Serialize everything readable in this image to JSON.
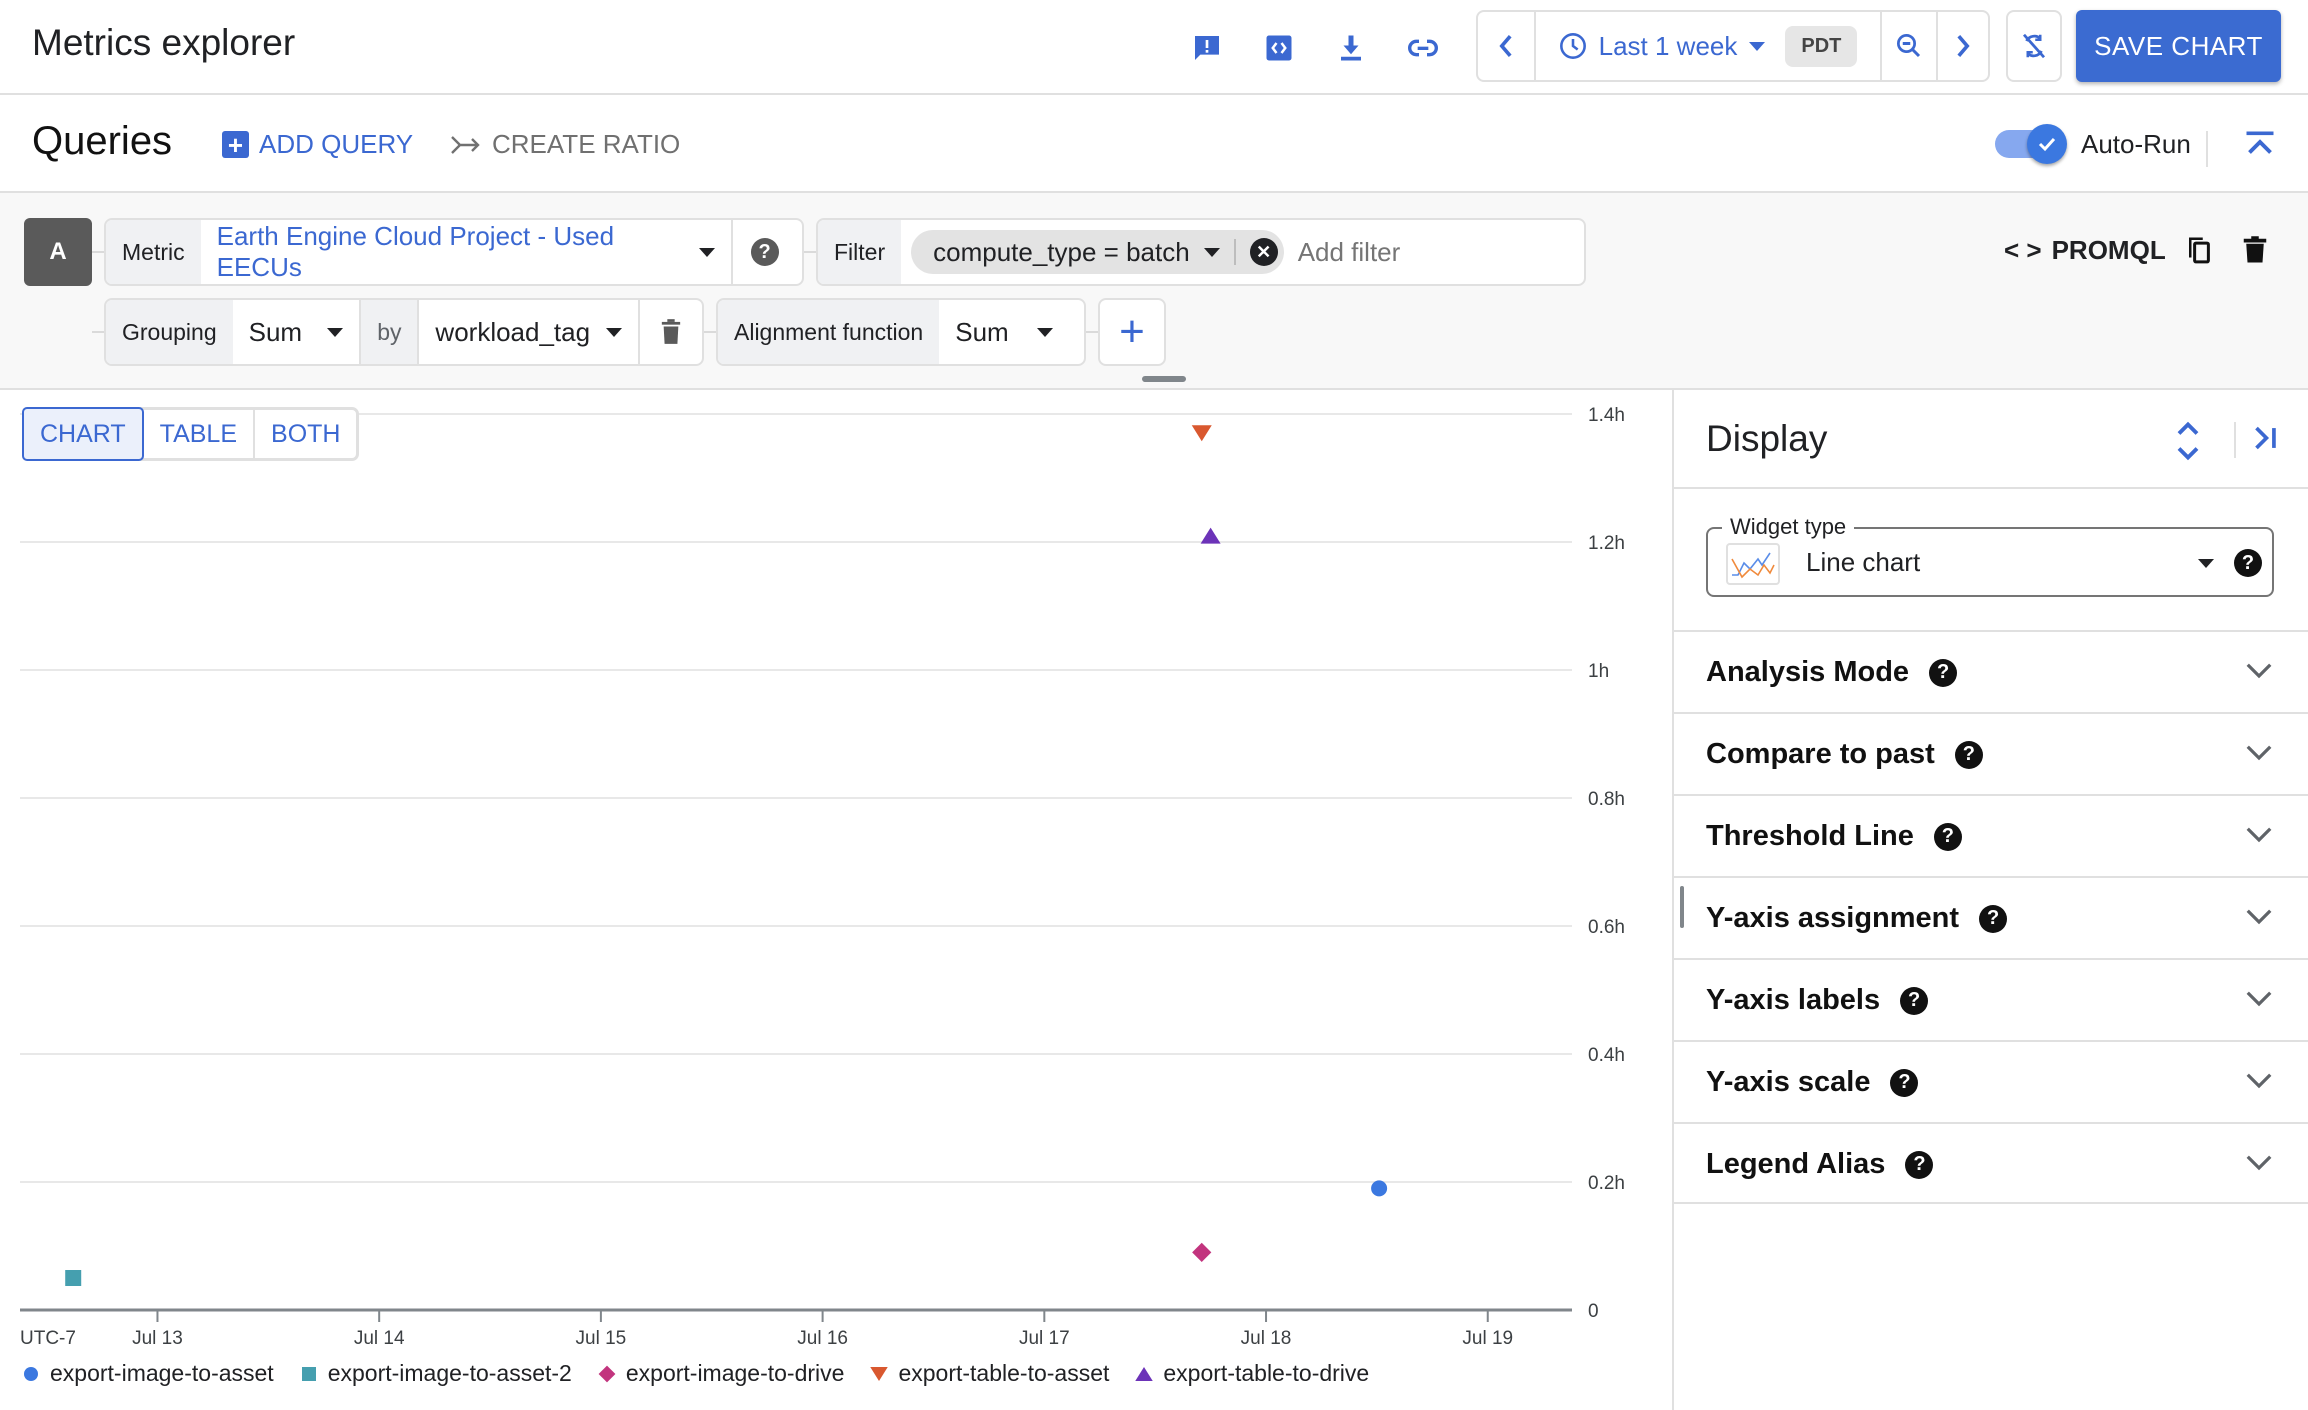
{
  "header": {
    "title": "Metrics explorer",
    "icons": [
      "feedback-icon",
      "api-code-icon",
      "download-icon",
      "link-icon"
    ],
    "time_range": "Last 1 week",
    "timezone": "PDT",
    "save_label": "SAVE CHART"
  },
  "queries": {
    "title": "Queries",
    "add_query": "ADD QUERY",
    "create_ratio": "CREATE RATIO",
    "autorun_label": "Auto-Run",
    "autorun_enabled": true
  },
  "query_a": {
    "letter": "A",
    "metric_label": "Metric",
    "metric_value": "Earth Engine Cloud Project - Used EECUs",
    "filter_label": "Filter",
    "filter_chip": "compute_type = batch",
    "filter_placeholder": "Add filter",
    "promql_label": "PROMQL",
    "grouping_label": "Grouping",
    "grouping_value": "Sum",
    "by_label": "by",
    "by_value": "workload_tag",
    "alignment_label": "Alignment function",
    "alignment_value": "Sum"
  },
  "view_toggle": {
    "options": [
      "CHART",
      "TABLE",
      "BOTH"
    ],
    "active": "CHART"
  },
  "display": {
    "title": "Display",
    "widget_type_label": "Widget type",
    "widget_type_value": "Line chart",
    "sections": [
      "Analysis Mode",
      "Compare to past",
      "Threshold Line",
      "Y-axis assignment",
      "Y-axis labels",
      "Y-axis scale",
      "Legend Alias"
    ]
  },
  "chart_data": {
    "type": "scatter",
    "title": "",
    "xlabel": "",
    "ylabel": "",
    "timezone_label": "UTC-7",
    "x_tick_labels": [
      "Jul 13",
      "Jul 14",
      "Jul 15",
      "Jul 16",
      "Jul 17",
      "Jul 18",
      "Jul 19"
    ],
    "x_range_days": [
      12.38,
      19.38
    ],
    "y_tick_labels": [
      "0",
      "0.2h",
      "0.4h",
      "0.6h",
      "0.8h",
      "1h",
      "1.2h",
      "1.4h"
    ],
    "y_ticks_hours": [
      0,
      0.2,
      0.4,
      0.6,
      0.8,
      1.0,
      1.2,
      1.4
    ],
    "ylim": [
      0,
      1.4
    ],
    "grid": true,
    "y_axis_side": "right",
    "legend_position": "bottom",
    "series": [
      {
        "name": "export-image-to-asset",
        "color": "#3b78e0",
        "marker": "circle",
        "points": [
          {
            "x_day": 18.51,
            "y": 0.19
          }
        ]
      },
      {
        "name": "export-image-to-asset-2",
        "color": "#459faf",
        "marker": "square",
        "points": [
          {
            "x_day": 12.62,
            "y": 0.05
          }
        ]
      },
      {
        "name": "export-image-to-drive",
        "color": "#c2347e",
        "marker": "diamond",
        "points": [
          {
            "x_day": 17.71,
            "y": 0.09
          }
        ]
      },
      {
        "name": "export-table-to-asset",
        "color": "#d9582f",
        "marker": "triangle-down",
        "points": [
          {
            "x_day": 17.71,
            "y": 1.37
          }
        ]
      },
      {
        "name": "export-table-to-drive",
        "color": "#6c33b8",
        "marker": "triangle-up",
        "points": [
          {
            "x_day": 17.75,
            "y": 1.21
          }
        ]
      }
    ]
  }
}
